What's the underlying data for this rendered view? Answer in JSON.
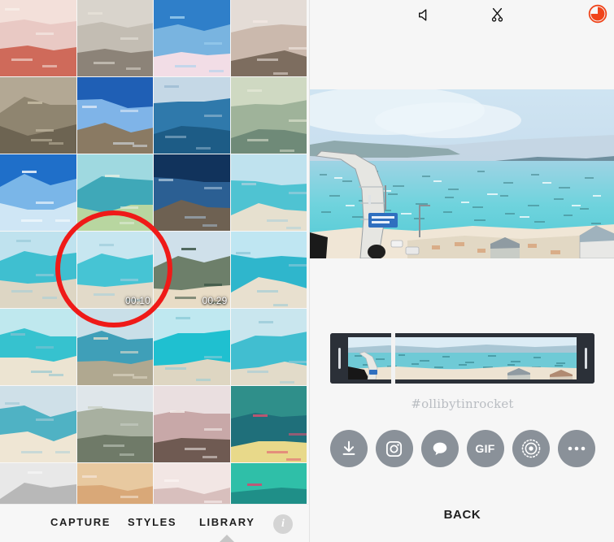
{
  "app": {
    "name": "video-editor",
    "accent_orange": "#f0441a",
    "annotation_color": "#ef1a18",
    "share_button_color": "#8a9199",
    "panel_background": "#f6f6f6"
  },
  "library": {
    "tabs": [
      {
        "id": "capture",
        "label": "CAPTURE",
        "active": false
      },
      {
        "id": "styles",
        "label": "STYLES",
        "active": false
      },
      {
        "id": "library",
        "label": "LIBRARY",
        "active": true
      }
    ],
    "info_button_label": "i",
    "grid": {
      "columns": 4,
      "items": [
        {
          "id": "t1",
          "alt": "cherry-blossom-street",
          "duration": ""
        },
        {
          "id": "t2",
          "alt": "blossom-tower-dusk",
          "duration": ""
        },
        {
          "id": "t3",
          "alt": "blossom-blue-sky",
          "duration": ""
        },
        {
          "id": "t4",
          "alt": "blossom-building",
          "duration": ""
        },
        {
          "id": "t5",
          "alt": "forest-hillside",
          "duration": ""
        },
        {
          "id": "t6",
          "alt": "lighthouse",
          "duration": ""
        },
        {
          "id": "t7",
          "alt": "ocean-horizon",
          "duration": ""
        },
        {
          "id": "t8",
          "alt": "coast-overlook",
          "duration": ""
        },
        {
          "id": "t9",
          "alt": "blue-sky-hill",
          "duration": ""
        },
        {
          "id": "t10",
          "alt": "cape-viewpoint",
          "duration": ""
        },
        {
          "id": "t11",
          "alt": "lighthouse-silhouette",
          "duration": ""
        },
        {
          "id": "t12",
          "alt": "bridge-seaside-road",
          "duration": ""
        },
        {
          "id": "t13",
          "alt": "bridge-over-turquoise-sea",
          "duration": ""
        },
        {
          "id": "t14",
          "alt": "bridge-island-selected",
          "duration": "00:10",
          "selected": true
        },
        {
          "id": "t15",
          "alt": "beach-cape",
          "duration": "00:29"
        },
        {
          "id": "t16",
          "alt": "bridge-coast-aerial",
          "duration": ""
        },
        {
          "id": "t17",
          "alt": "beach-cove",
          "duration": ""
        },
        {
          "id": "t18",
          "alt": "cliff-coast",
          "duration": ""
        },
        {
          "id": "t19",
          "alt": "bridge-turquoise-water",
          "duration": ""
        },
        {
          "id": "t20",
          "alt": "bridge-long-span",
          "duration": ""
        },
        {
          "id": "t21",
          "alt": "beach-shoreline",
          "duration": ""
        },
        {
          "id": "t22",
          "alt": "pier-structure",
          "duration": ""
        },
        {
          "id": "t23",
          "alt": "blossom-branches-sky",
          "duration": ""
        },
        {
          "id": "t24",
          "alt": "aquarium-pool",
          "duration": ""
        },
        {
          "id": "t25",
          "alt": "white-gate-bw",
          "duration": ""
        },
        {
          "id": "t26",
          "alt": "blossom-orange-wall",
          "duration": ""
        },
        {
          "id": "t27",
          "alt": "blossom-dense",
          "duration": ""
        },
        {
          "id": "t28",
          "alt": "teal-map-graphic",
          "duration": ""
        }
      ]
    }
  },
  "editor": {
    "toolbar": [
      {
        "id": "mute",
        "icon": "speaker-mute-icon",
        "label": "Mute"
      },
      {
        "id": "cut",
        "icon": "scissors-icon",
        "label": "Trim"
      },
      {
        "id": "progress",
        "icon": "progress-pie-icon",
        "label": "Duration",
        "value_percent": 75
      }
    ],
    "preview": {
      "alt": "bridge-over-turquoise-sea-stylized"
    },
    "timeline": {
      "left_handle_label": "trim-start",
      "right_handle_label": "trim-end",
      "playhead_position_percent": 23
    },
    "hashtag": "#ollibytinrocket",
    "share_buttons": [
      {
        "id": "save",
        "icon": "download-icon",
        "label": "Save"
      },
      {
        "id": "instagram",
        "icon": "instagram-icon",
        "label": "Instagram"
      },
      {
        "id": "message",
        "icon": "message-icon",
        "label": "Message"
      },
      {
        "id": "gif",
        "icon": "gif-icon",
        "label": "GIF"
      },
      {
        "id": "loop",
        "icon": "loop-target-icon",
        "label": "Loop"
      },
      {
        "id": "more",
        "icon": "ellipsis-icon",
        "label": "More"
      }
    ],
    "back_label": "BACK"
  }
}
